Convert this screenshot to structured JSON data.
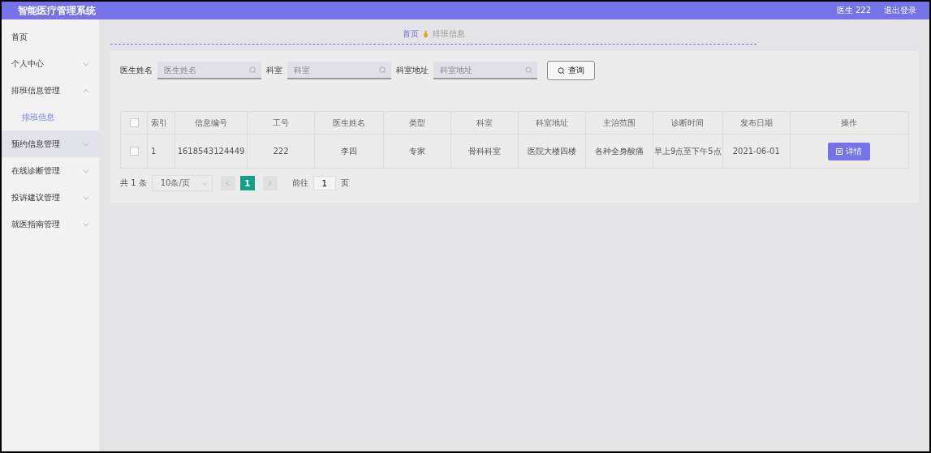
{
  "header": {
    "title": "智能医疗管理系统",
    "user": "医生 222",
    "logout": "退出登录"
  },
  "sidebar": {
    "items": [
      {
        "label": "首页",
        "kind": "link",
        "highlighted": false
      },
      {
        "label": "个人中心",
        "kind": "group",
        "expanded": false,
        "highlighted": false
      },
      {
        "label": "排班信息管理",
        "kind": "group",
        "expanded": true,
        "highlighted": false,
        "children": [
          {
            "label": "排班信息",
            "selected": true
          }
        ]
      },
      {
        "label": "预约信息管理",
        "kind": "group",
        "expanded": false,
        "highlighted": true
      },
      {
        "label": "在线诊断管理",
        "kind": "group",
        "expanded": false,
        "highlighted": false
      },
      {
        "label": "投诉建议管理",
        "kind": "group",
        "expanded": false,
        "highlighted": false
      },
      {
        "label": "就医指南管理",
        "kind": "group",
        "expanded": false,
        "highlighted": false
      }
    ]
  },
  "breadcrumb": [
    {
      "label": "首页"
    },
    {
      "label": "排班信息"
    }
  ],
  "search": {
    "fields": [
      {
        "label": "医生姓名",
        "placeholder": "医生姓名"
      },
      {
        "label": "科室",
        "placeholder": "科室"
      },
      {
        "label": "科室地址",
        "placeholder": "科室地址"
      }
    ],
    "button": "查询"
  },
  "table": {
    "all_checked": false,
    "columns": [
      "索引",
      "信息编号",
      "工号",
      "医生姓名",
      "类型",
      "科室",
      "科室地址",
      "主治范围",
      "诊断时间",
      "发布日期",
      "操作"
    ],
    "rows": [
      {
        "checked": false,
        "cells": [
          "1",
          "1618543124449",
          "222",
          "李四",
          "专家",
          "骨科科室",
          "医院大楼四楼",
          "各种全身酸痛",
          "早上9点至下午5点",
          "2021-06-01"
        ],
        "action": "详情"
      }
    ]
  },
  "pagination": {
    "total": "共 1 条",
    "page_size": "10条/页",
    "pages": [
      {
        "label": "1",
        "selected": true
      }
    ],
    "goto_label": "前往",
    "goto_value": "1",
    "goto_suffix": "页"
  }
}
